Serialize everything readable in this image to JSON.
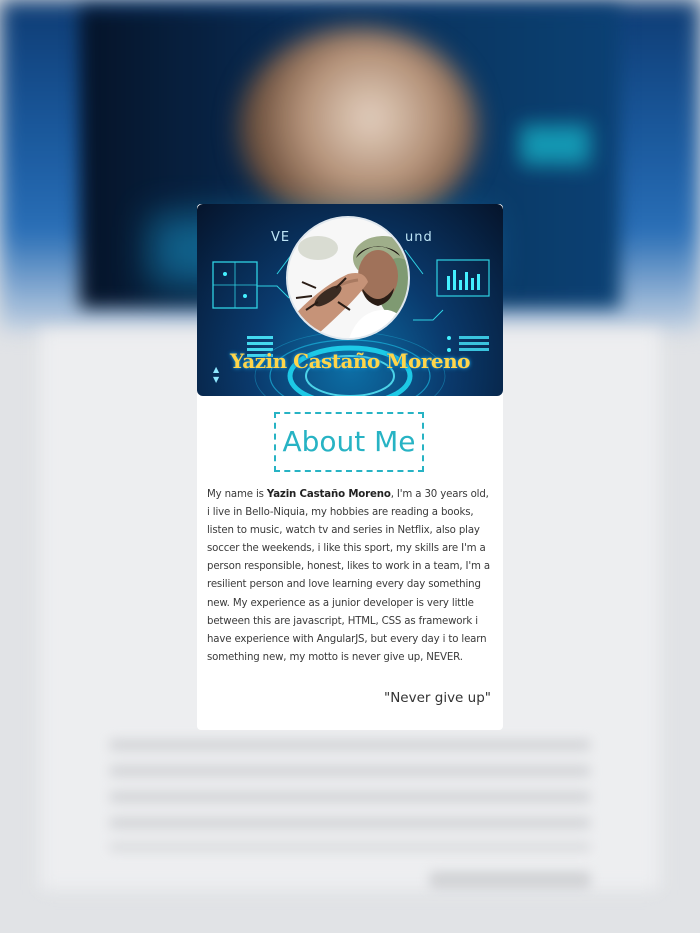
{
  "profile": {
    "name": "Yazin Castaño Moreno",
    "banner_word_left": "VE",
    "banner_word_right": "und"
  },
  "about": {
    "title": "About Me",
    "intro": "My name is ",
    "name_bold": "Yazin Castaño Moreno",
    "body": ", I'm a 30 years old, i live in Bello-Niquia, my hobbies are reading a books, listen to music, watch tv and series in Netflix, also play soccer the weekends, i like this sport, my skills are I'm a person responsible, honest, likes to work in a team, I'm a resilient person and love learning every day something new. My experience as a junior developer is very little between this are javascript, HTML, CSS as framework i have experience with AngularJS, but every day i to learn something new, my motto is never give up, NEVER.",
    "motto": "\"Never give up\""
  },
  "colors": {
    "accent": "#27b3c4",
    "name_yellow": "#ffd54a",
    "banner_blue": "#0a3a6d"
  }
}
